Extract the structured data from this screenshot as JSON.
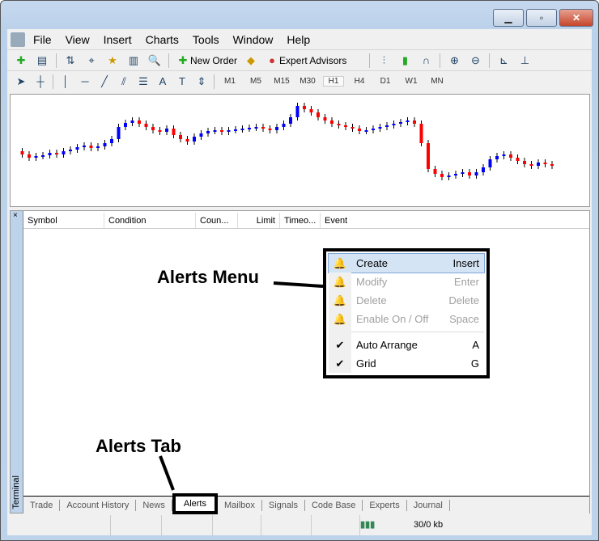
{
  "window": {
    "minimize": "▁",
    "maximize": "▫",
    "close": "✕"
  },
  "menubar": [
    "File",
    "View",
    "Insert",
    "Charts",
    "Tools",
    "Window",
    "Help"
  ],
  "toolbar": {
    "new_order": "New Order",
    "expert_advisors": "Expert Advisors"
  },
  "timeframes": [
    "M1",
    "M5",
    "M15",
    "M30",
    "H1",
    "H4",
    "D1",
    "W1",
    "MN"
  ],
  "selected_timeframe": "H1",
  "columns": [
    "Symbol",
    "Condition",
    "Coun...",
    "Limit",
    "Timeo...",
    "Event"
  ],
  "terminal_label": "Terminal",
  "tabs": [
    "Trade",
    "Account History",
    "News",
    "Alerts",
    "Mailbox",
    "Signals",
    "Code Base",
    "Experts",
    "Journal"
  ],
  "active_tab": "Alerts",
  "context_menu": [
    {
      "label": "Create",
      "shortcut": "Insert",
      "icon": "bell-add-icon",
      "enabled": true,
      "selected": true
    },
    {
      "label": "Modify",
      "shortcut": "Enter",
      "icon": "bell-gear-icon",
      "enabled": false
    },
    {
      "label": "Delete",
      "shortcut": "Delete",
      "icon": "bell-delete-icon",
      "enabled": false
    },
    {
      "label": "Enable On / Off",
      "shortcut": "Space",
      "icon": "bell-pause-icon",
      "enabled": false
    },
    {
      "label": "Auto Arrange",
      "shortcut": "A",
      "checked": true,
      "enabled": true
    },
    {
      "label": "Grid",
      "shortcut": "G",
      "checked": true,
      "enabled": true
    }
  ],
  "status": {
    "traffic": "30/0 kb"
  },
  "annotations": {
    "menu": "Alerts Menu",
    "tab": "Alerts Tab"
  },
  "colors": {
    "bull": "#0000ff",
    "bear": "#ff0000"
  }
}
